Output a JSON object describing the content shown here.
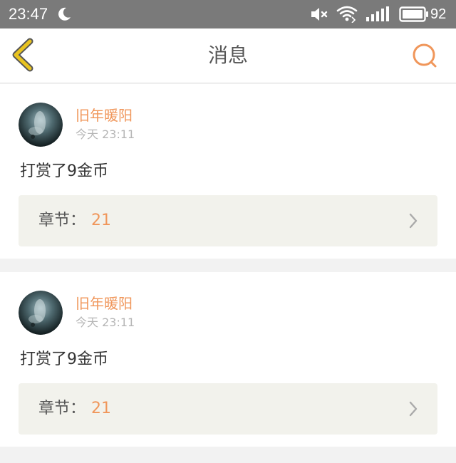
{
  "status_bar": {
    "time": "23:47",
    "battery_level": "92",
    "icons": [
      "moon-icon",
      "mute-icon",
      "wifi-icon",
      "signal-icon",
      "battery-icon"
    ]
  },
  "nav": {
    "title": "消息",
    "back_icon": "chevron-left-icon",
    "search_icon": "search-icon"
  },
  "messages": [
    {
      "sender": "旧年暖阳",
      "time": "今天 23:11",
      "text": "打赏了9金币",
      "chapter_label": "章节：",
      "chapter_value": "21"
    },
    {
      "sender": "旧年暖阳",
      "time": "今天 23:11",
      "text": "打赏了9金币",
      "chapter_label": "章节：",
      "chapter_value": "21"
    }
  ],
  "colors": {
    "accent": "#f0965a",
    "back_arrow": "#e8c320",
    "status_bar_bg": "#7a7a7a",
    "page_bg": "#f2f2f2",
    "chapter_row_bg": "#f2f2ec"
  }
}
